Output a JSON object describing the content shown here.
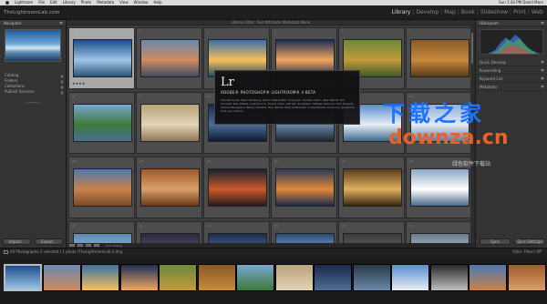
{
  "menubar": {
    "items": [
      "Lightroom",
      "File",
      "Edit",
      "Library",
      "Photo",
      "Metadata",
      "View",
      "Window",
      "Help"
    ],
    "status": "Sun 1:34 PM  David Marx"
  },
  "identity": {
    "title": "TheLightroomLab.com"
  },
  "modules": [
    "Library",
    "Develop",
    "Map",
    "Book",
    "Slideshow",
    "Print",
    "Web"
  ],
  "left_panel": {
    "navigator_label": "Navigator",
    "sections": [
      "Catalog",
      "Folders",
      "Collections",
      "Publish Services"
    ],
    "import_label": "Import...",
    "export_label": "Export..."
  },
  "right_panel": {
    "histogram_label": "Histogram",
    "rows": [
      {
        "label": "Quick Develop",
        "value": ""
      },
      {
        "label": "Keywording",
        "value": ""
      },
      {
        "label": "Keyword List",
        "value": ""
      },
      {
        "label": "Metadata",
        "value": ""
      }
    ],
    "sync_label": "Sync",
    "sync_settings_label": "Sync Settings"
  },
  "grid": {
    "filter_label": "Library Filter:  Text  Attribute  Metadata  None",
    "rows": [
      [
        {
          "id": "2",
          "colors": [
            "#1a4d8a",
            "#9fc4e6",
            "#2a5577"
          ],
          "selected": true,
          "stars": "★★★★"
        },
        {
          "id": "3",
          "colors": [
            "#6a89b0",
            "#d08a5f",
            "#3d4c63"
          ],
          "selected": false,
          "stars": ""
        },
        {
          "id": "4",
          "colors": [
            "#3b6fa8",
            "#f6c15a",
            "#234866"
          ],
          "selected": false,
          "stars": ""
        },
        {
          "id": "5",
          "colors": [
            "#1c2f55",
            "#f2a660",
            "#162b45"
          ],
          "selected": false,
          "stars": ""
        },
        {
          "id": "6",
          "colors": [
            "#6b8a3a",
            "#c49a3c",
            "#3e5a2a"
          ],
          "selected": false,
          "stars": ""
        },
        {
          "id": "7",
          "colors": [
            "#8a5a26",
            "#c88a3e",
            "#5a3a1a"
          ],
          "selected": false,
          "stars": ""
        }
      ],
      [
        {
          "id": "8",
          "colors": [
            "#7aa6d1",
            "#3c7a3a",
            "#4a6f8f"
          ],
          "selected": false,
          "stars": ""
        },
        {
          "id": "9",
          "colors": [
            "#b8a27c",
            "#e3d4b6",
            "#8c7756"
          ],
          "selected": false,
          "stars": ""
        },
        {
          "id": "10",
          "colors": [
            "#1a2a48",
            "#4d6e96",
            "#0e1a30"
          ],
          "selected": false,
          "stars": ""
        },
        {
          "id": "11",
          "colors": [
            "#2a3a4a",
            "#6a8aa8",
            "#1a2430"
          ],
          "selected": false,
          "stars": ""
        },
        {
          "id": "12",
          "colors": [
            "#5a8ccf",
            "#e8eef5",
            "#3d6a8e"
          ],
          "selected": false,
          "stars": ""
        },
        {
          "id": "13",
          "colors": [
            "#8fb0d8",
            "#e4e9f0",
            "#5a7ca6"
          ],
          "selected": false,
          "stars": ""
        }
      ],
      [
        {
          "id": "14",
          "colors": [
            "#4c78b2",
            "#c9824a",
            "#7a4a2a"
          ],
          "selected": false,
          "stars": ""
        },
        {
          "id": "15",
          "colors": [
            "#a05a2a",
            "#d8a06a",
            "#6a3a1a"
          ],
          "selected": false,
          "stars": ""
        },
        {
          "id": "16",
          "colors": [
            "#1a2030",
            "#c85a2a",
            "#2a1a1a"
          ],
          "selected": false,
          "stars": ""
        },
        {
          "id": "17",
          "colors": [
            "#2a3a5a",
            "#e08a3a",
            "#1a2a4a"
          ],
          "selected": false,
          "stars": ""
        },
        {
          "id": "18",
          "colors": [
            "#5a3a1a",
            "#e0b060",
            "#3a2410"
          ],
          "selected": false,
          "stars": ""
        },
        {
          "id": "19",
          "colors": [
            "#8aa8c8",
            "#ffffff",
            "#4a6a8a"
          ],
          "selected": false,
          "stars": ""
        }
      ],
      [
        {
          "id": "20",
          "colors": [
            "#5a8ab8",
            "#9ab8d8",
            "#3a5a7a"
          ],
          "selected": false,
          "stars": ""
        },
        {
          "id": "21",
          "colors": [
            "#2a2a3a",
            "#5a5a7a",
            "#1a1a2a"
          ],
          "selected": false,
          "stars": ""
        },
        {
          "id": "22",
          "colors": [
            "#1a2a4a",
            "#5a7aa8",
            "#0e1a2e"
          ],
          "selected": false,
          "stars": ""
        },
        {
          "id": "23",
          "colors": [
            "#2a4a7a",
            "#8ab0d8",
            "#1a2a4a"
          ],
          "selected": false,
          "stars": ""
        },
        {
          "id": "24",
          "colors": [
            "#3a3a3a",
            "#6a6a6a",
            "#2a2a2a"
          ],
          "selected": false,
          "stars": ""
        },
        {
          "id": "25",
          "colors": [
            "#6a7a8a",
            "#b8c8d8",
            "#4a5a6a"
          ],
          "selected": false,
          "stars": ""
        }
      ]
    ]
  },
  "toolbar": {
    "sort_label": "Sort: Rating"
  },
  "filmstrip_bar": {
    "left_text": "All Photographs   2 selected / 1 photo /TheLightroomLab-1.dng",
    "filter_label": "Filter:",
    "filter_value": "Filters Off"
  },
  "filmstrip": [
    {
      "colors": [
        "#1a4d8a",
        "#9fc4e6"
      ],
      "selected": true
    },
    {
      "colors": [
        "#6a89b0",
        "#d08a5f"
      ],
      "selected": false
    },
    {
      "colors": [
        "#3b6fa8",
        "#f6c15a"
      ],
      "selected": false
    },
    {
      "colors": [
        "#1c2f55",
        "#f2a660"
      ],
      "selected": false
    },
    {
      "colors": [
        "#6b8a3a",
        "#c49a3c"
      ],
      "selected": false
    },
    {
      "colors": [
        "#8a5a26",
        "#c88a3e"
      ],
      "selected": false
    },
    {
      "colors": [
        "#7aa6d1",
        "#3c7a3a"
      ],
      "selected": false
    },
    {
      "colors": [
        "#b8a27c",
        "#e3d4b6"
      ],
      "selected": false
    },
    {
      "colors": [
        "#1a2a48",
        "#4d6e96"
      ],
      "selected": false
    },
    {
      "colors": [
        "#2a3a4a",
        "#6a8aa8"
      ],
      "selected": false
    },
    {
      "colors": [
        "#5a8ccf",
        "#e8eef5"
      ],
      "selected": false
    },
    {
      "colors": [
        "#2a2a2a",
        "#bfbfbf"
      ],
      "selected": false
    },
    {
      "colors": [
        "#4c78b2",
        "#c9824a"
      ],
      "selected": false
    },
    {
      "colors": [
        "#a05a2a",
        "#d8a06a"
      ],
      "selected": false
    }
  ],
  "splash": {
    "logo": "Lr",
    "product": "ADOBE® PHOTOSHOP® LIGHTROOM® 4 BETA",
    "credits": "Thomas Knoll, Mark Hamburg, Kevin Tieskoetter, Troy Gaul, Zalman Stern, Max Wendt, Eric Scouten, Ben Zibble, Julie Kmoch, Donna Chan, Jeff Van de Walker, Melissa Itamura, Tom Hogarty, Sharad Mangalick, Becky Sowada, Ben Warde, Ruth Orlikowski, Craig Marble, Chris Cox, Julieanne Kost, Jerry Harris"
  },
  "watermark": {
    "cn": "下载之家",
    "en": "downza.cn",
    "sub": "绿色软件下载站"
  },
  "colors": {
    "grid_bg": "#3c3c3c",
    "panel_bg": "#333333",
    "selected_cell": "#a8a8a8",
    "watermark_blue": "#1b73ff",
    "watermark_orange": "#e7612b"
  }
}
